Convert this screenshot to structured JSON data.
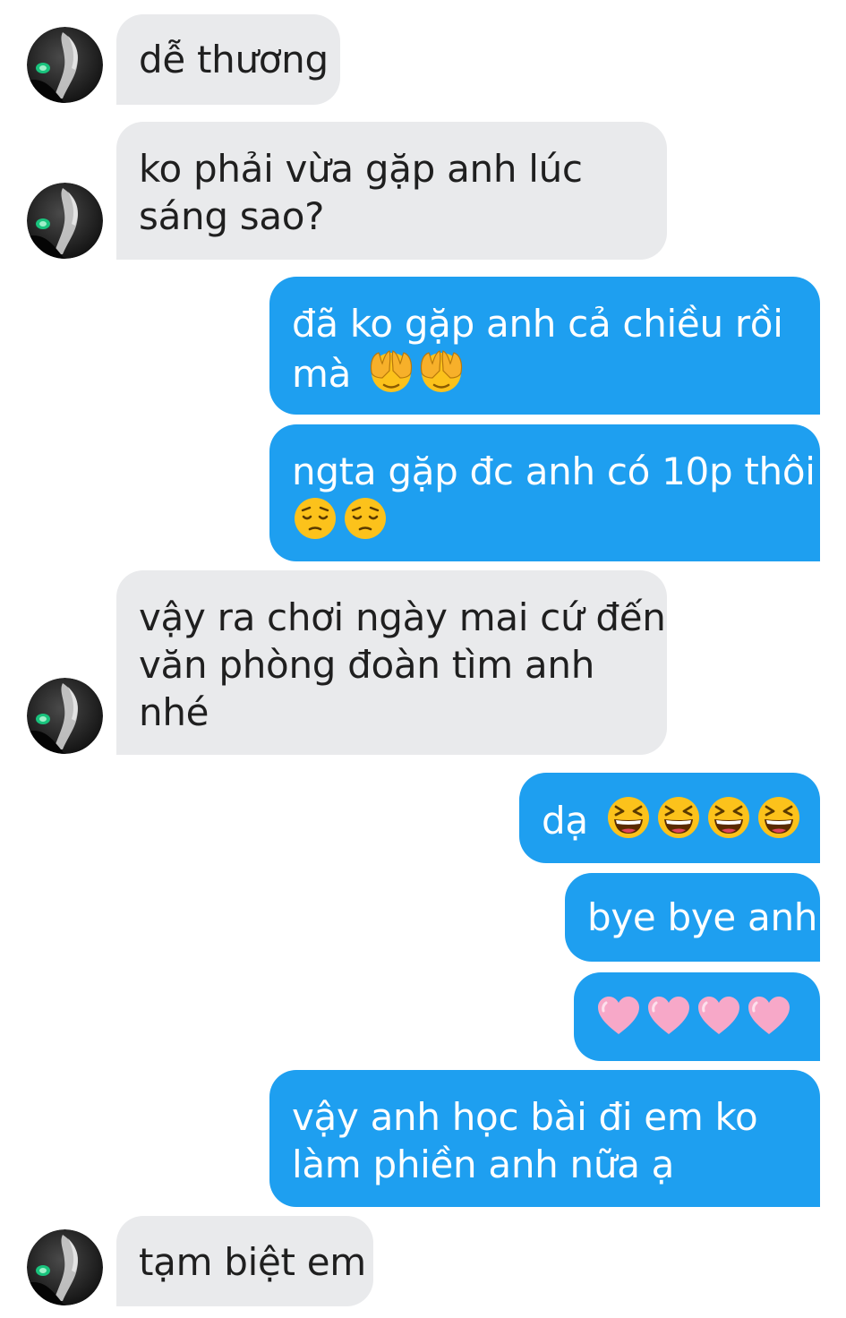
{
  "conversation": {
    "messages": [
      {
        "sender": "contact",
        "lines": [
          "dễ thương"
        ]
      },
      {
        "sender": "contact",
        "lines": [
          "ko phải vừa gặp anh lúc",
          "sáng sao?"
        ]
      },
      {
        "sender": "me",
        "lines": [
          "đã ko gặp anh cả chiều rồi",
          "mà"
        ],
        "emoji": [
          "face-covering-eyes-emoji",
          "face-covering-eyes-emoji"
        ]
      },
      {
        "sender": "me",
        "lines": [
          "ngta gặp đc anh có 10p thôi"
        ],
        "emoji": [
          "pensive-face-emoji",
          "pensive-face-emoji"
        ]
      },
      {
        "sender": "contact",
        "lines": [
          "vậy ra chơi ngày mai cứ đến",
          "văn phòng đoàn tìm anh",
          "nhé"
        ]
      },
      {
        "sender": "me",
        "lines": [
          "dạ"
        ],
        "emoji": [
          "laughing-face-emoji",
          "laughing-face-emoji",
          "laughing-face-emoji",
          "laughing-face-emoji"
        ]
      },
      {
        "sender": "me",
        "lines": [
          "bye bye anh"
        ]
      },
      {
        "sender": "me",
        "lines": [],
        "emoji": [
          "pink-heart-emoji",
          "pink-heart-emoji",
          "pink-heart-emoji",
          "pink-heart-emoji"
        ]
      },
      {
        "sender": "me",
        "lines": [
          "vậy anh học bài đi em ko",
          "làm phiền anh nữa ạ"
        ]
      },
      {
        "sender": "contact",
        "lines": [
          "tạm biệt em"
        ]
      }
    ]
  },
  "colors": {
    "incoming_bubble": "#e9eaec",
    "outgoing_bubble": "#1e9ff0",
    "incoming_text": "#1f1f1f",
    "outgoing_text": "#ffffff"
  }
}
